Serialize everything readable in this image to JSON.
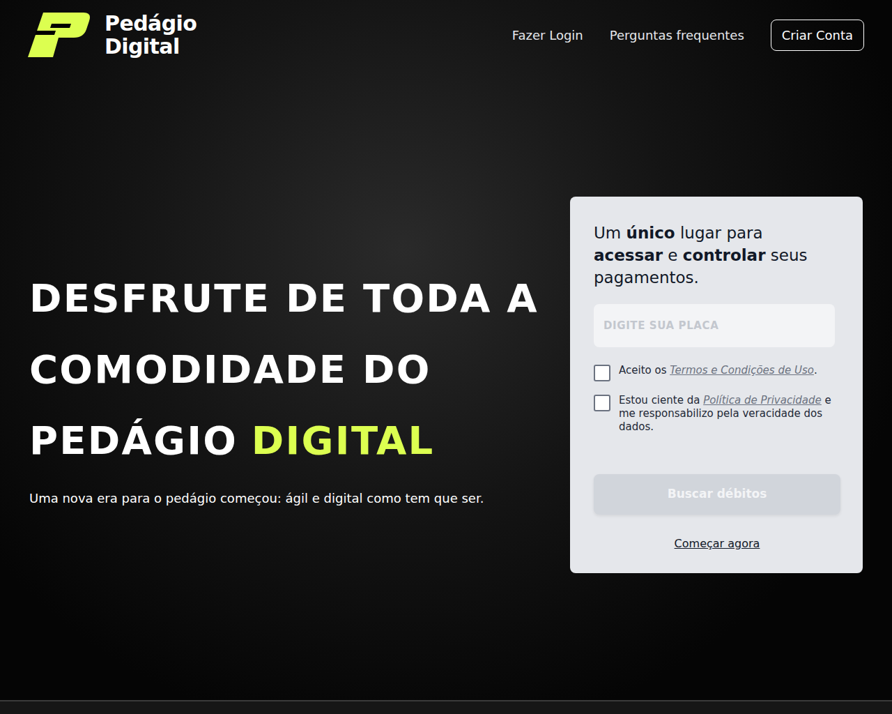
{
  "logo": {
    "line1": "Pedágio",
    "line2": "Digital"
  },
  "nav": {
    "links": [
      "Fazer Login",
      "Perguntas frequentes"
    ],
    "cta": "Criar Conta"
  },
  "hero": {
    "title_lines": [
      [
        {
          "text": "DESFRUTE DE TODA A",
          "highlight": false
        }
      ],
      [
        {
          "text": "COMODIDADE DO",
          "highlight": false
        }
      ],
      [
        {
          "text": "PEDÁGIO",
          "highlight": false
        },
        {
          "text": "DIGITAL",
          "highlight": true
        }
      ]
    ],
    "subtitle": "Uma nova era para o pedágio começou: ágil e digital como tem que ser."
  },
  "card": {
    "heading": [
      {
        "text": "Um ",
        "bold": false
      },
      {
        "text": "único",
        "bold": true
      },
      {
        "text": " lugar para ",
        "bold": false
      },
      {
        "text": "acessar",
        "bold": true
      },
      {
        "text": " e ",
        "bold": false
      },
      {
        "text": "controlar",
        "bold": true
      },
      {
        "text": " seus pagamentos.",
        "bold": false
      }
    ],
    "input": {
      "placeholder": "DIGITE SUA PLACA",
      "value": ""
    },
    "checkboxes": [
      {
        "checked": false,
        "parts": [
          {
            "text": "Aceito os ",
            "link": false
          },
          {
            "text": "Termos e Condições de Uso",
            "link": true
          },
          {
            "text": ".",
            "link": false
          }
        ]
      },
      {
        "checked": false,
        "parts": [
          {
            "text": "Estou ciente da ",
            "link": false
          },
          {
            "text": "Política de Privacidade",
            "link": true
          },
          {
            "text": " e me responsabilizo pela veracidade dos dados.",
            "link": false
          }
        ]
      }
    ],
    "button": {
      "label": "Buscar débitos",
      "disabled": true
    },
    "link": "Começar agora"
  }
}
